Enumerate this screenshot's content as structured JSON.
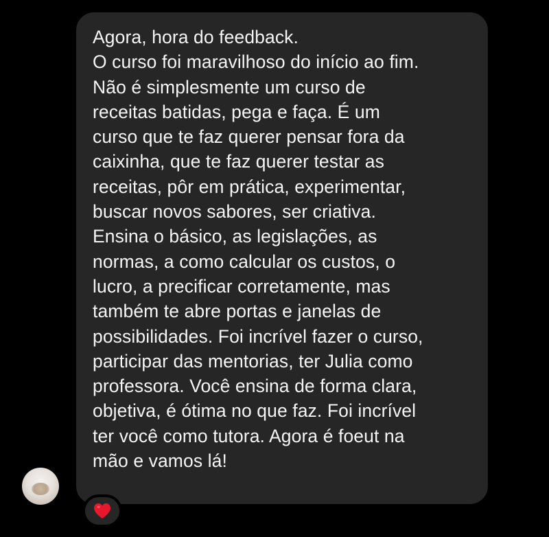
{
  "message": {
    "lines": [
      "Agora, hora do feedback.",
      "O curso foi maravilhoso do início ao fim.",
      "Não é simplesmente um curso de",
      "receitas batidas, pega e faça. É um",
      "curso que te faz querer pensar fora da",
      "caixinha, que te faz querer testar as",
      "receitas, pôr em prática, experimentar,",
      "buscar novos sabores, ser criativa.",
      "Ensina o básico, as legislações, as",
      "normas, a como calcular os custos, o",
      "lucro, a precificar corretamente, mas",
      "também te abre portas e janelas de",
      "possibilidades. Foi incrível fazer o curso,",
      "participar das mentorias, ter Julia como",
      "professora. Você ensina de forma clara,",
      "objetiva, é ótima no que faz. Foi incrível",
      "ter você como tutora. Agora é foeut na",
      "mão e vamos lá!"
    ]
  },
  "reaction": {
    "icon": "red-heart-icon",
    "color": "#e8182c"
  },
  "colors": {
    "background": "#000000",
    "bubble": "#262626",
    "text": "#f5f5f5"
  }
}
